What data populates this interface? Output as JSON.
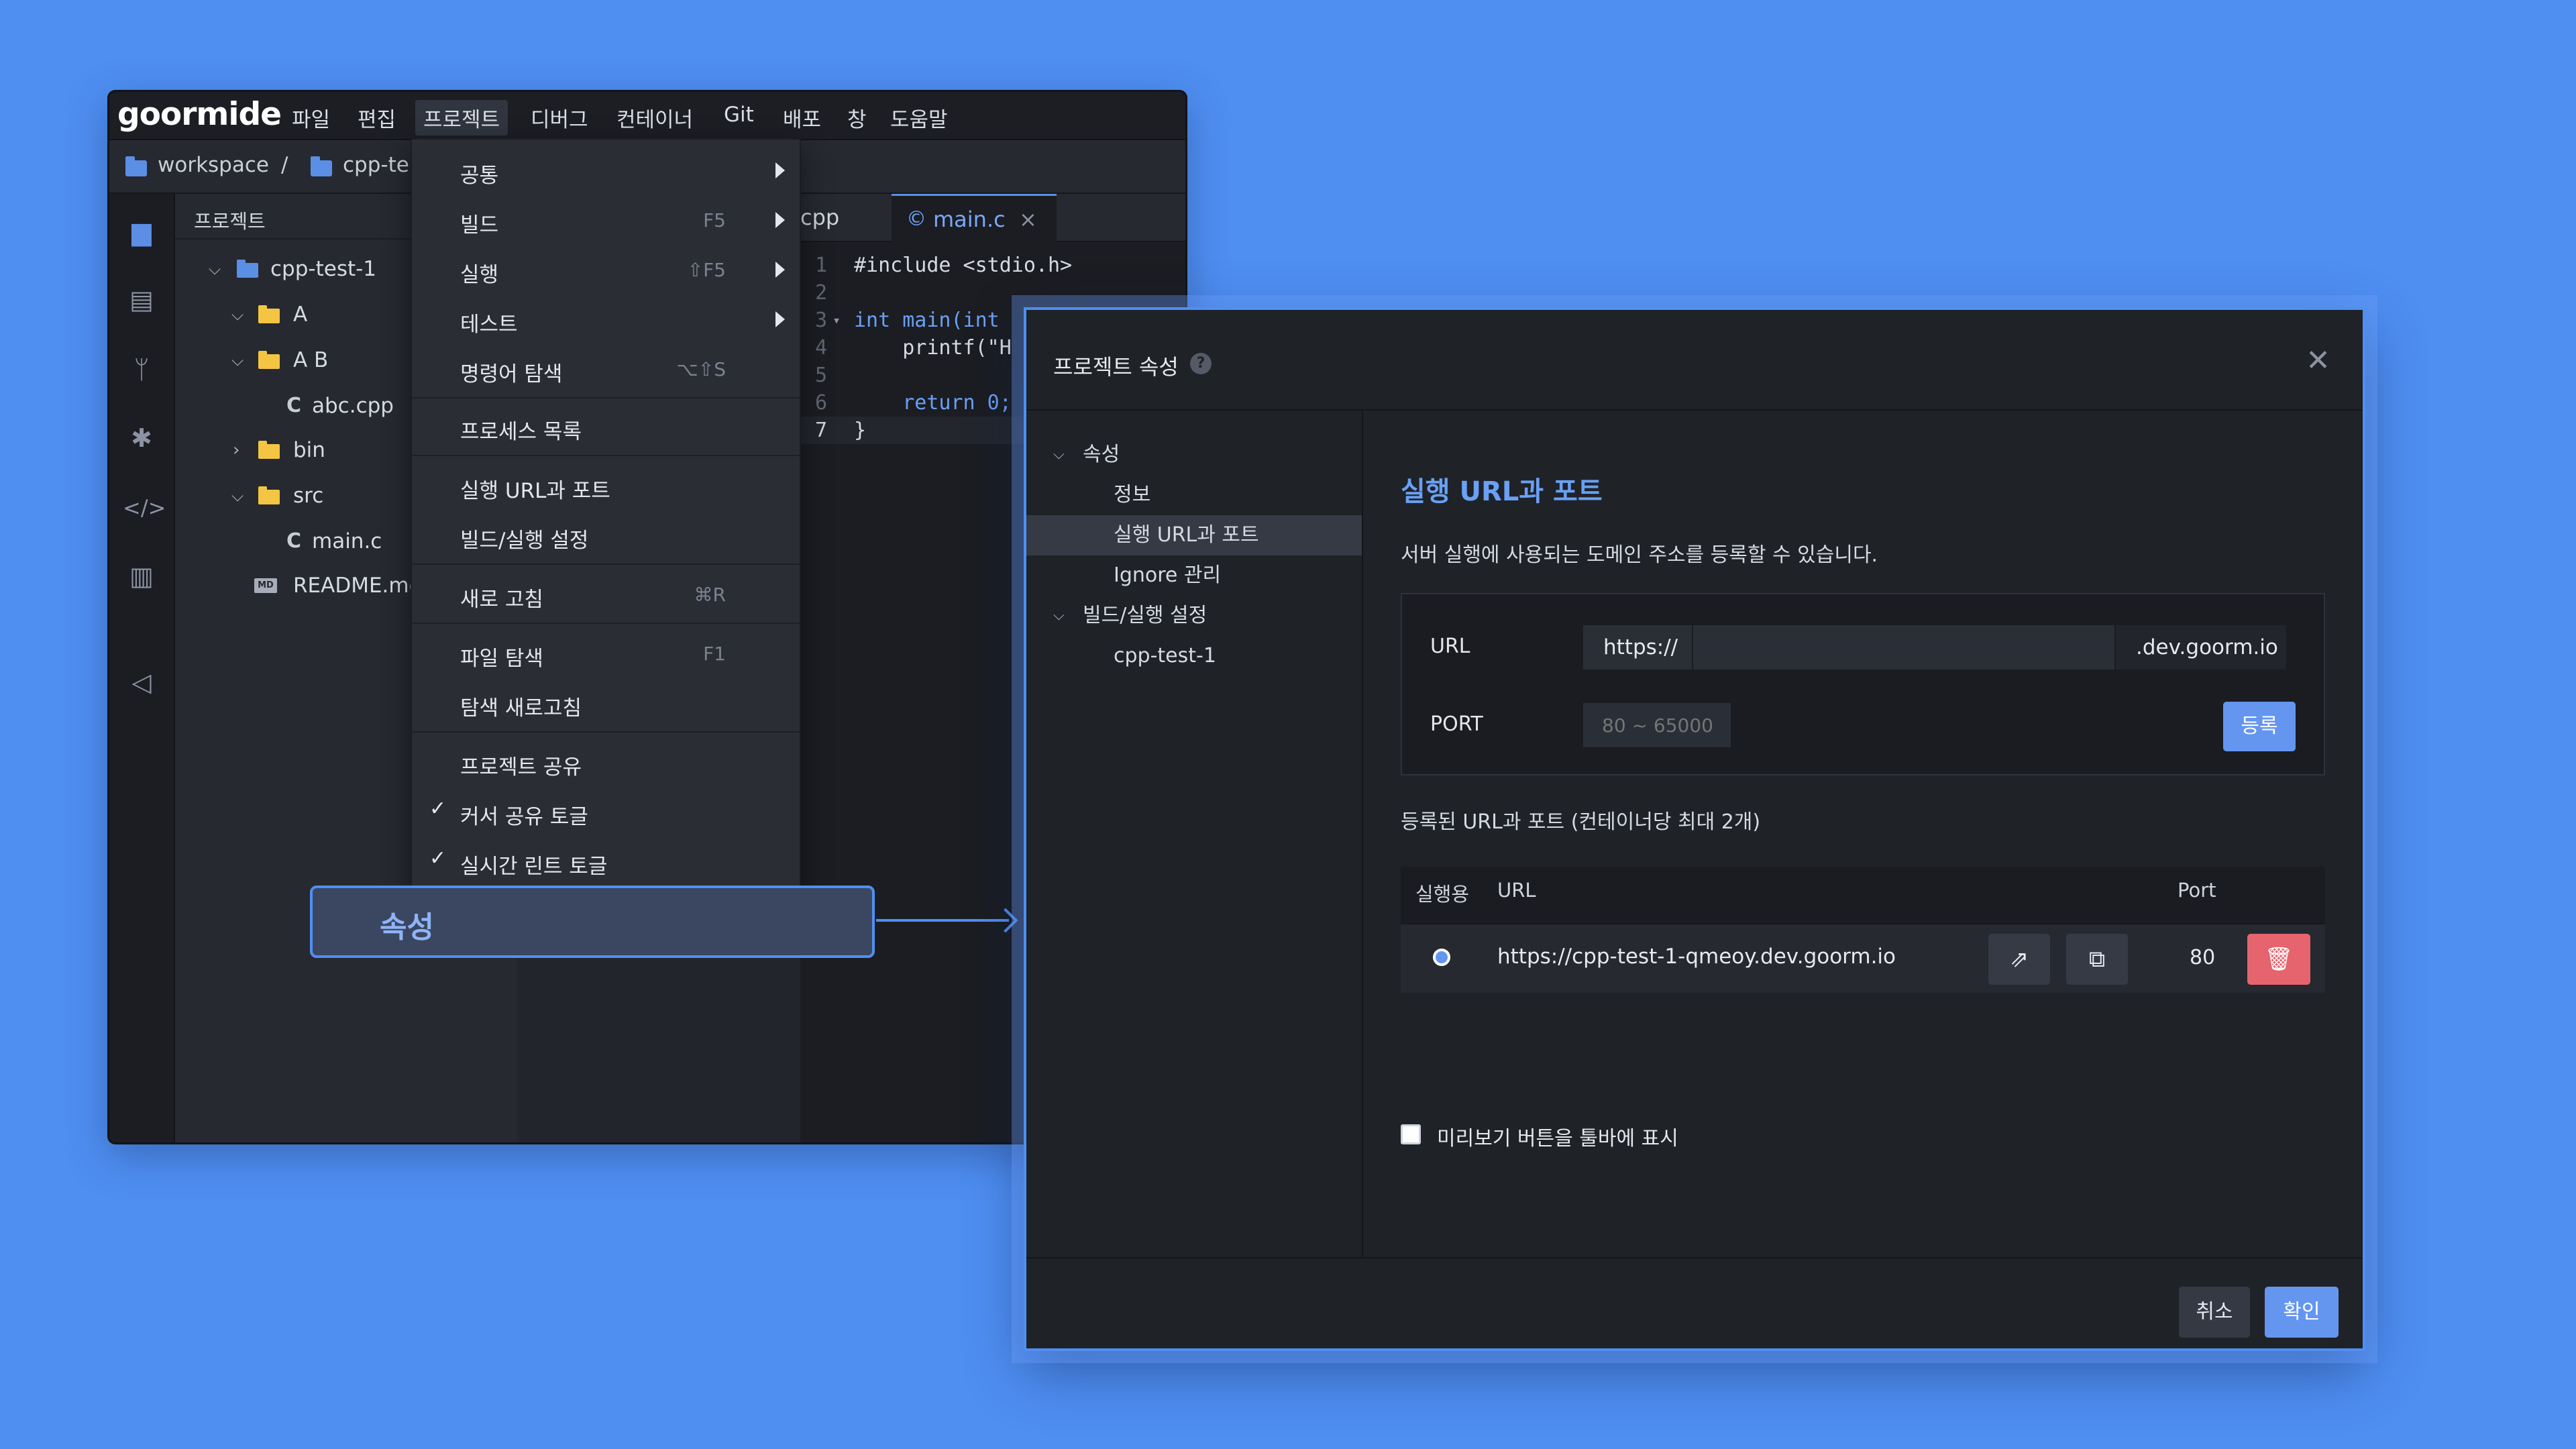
{
  "menubar": {
    "logo": "goormide",
    "items": [
      "파일",
      "편집",
      "프로젝트",
      "디버그",
      "컨테이너",
      "Git",
      "배포",
      "창",
      "도움말"
    ]
  },
  "breadcrumb": {
    "workspace": "workspace",
    "separator": "/",
    "project": "cpp-te"
  },
  "explorer": {
    "title": "프로젝트",
    "tree": [
      {
        "name": "cpp-test-1",
        "type": "project"
      },
      {
        "name": "A",
        "type": "folder"
      },
      {
        "name": "A B",
        "type": "folder"
      },
      {
        "name": "abc.cpp",
        "type": "file"
      },
      {
        "name": "bin",
        "type": "folder"
      },
      {
        "name": "src",
        "type": "folder"
      },
      {
        "name": "main.c",
        "type": "file"
      },
      {
        "name": "README.md",
        "type": "md"
      }
    ]
  },
  "editor": {
    "tabs": [
      {
        "label": "cpp"
      },
      {
        "label": "main.c"
      }
    ],
    "line_numbers": [
      "1",
      "2",
      "3",
      "4",
      "5",
      "6",
      "7"
    ],
    "lines": [
      "#include <stdio.h>",
      "",
      "int main(int",
      "    printf(\"H",
      "",
      "    return 0;",
      "}"
    ]
  },
  "dropdown": {
    "items": [
      {
        "label": "공통",
        "shortcut": "",
        "submenu": true
      },
      {
        "label": "빌드",
        "shortcut": "F5",
        "submenu": true
      },
      {
        "label": "실행",
        "shortcut": "⇧F5",
        "submenu": true
      },
      {
        "label": "테스트",
        "shortcut": "",
        "submenu": true
      },
      {
        "label": "명령어 탐색",
        "shortcut": "⌥⇧S"
      },
      {
        "label": "프로세스 목록",
        "shortcut": ""
      },
      {
        "label": "실행 URL과 포트",
        "shortcut": ""
      },
      {
        "label": "빌드/실행 설정",
        "shortcut": ""
      },
      {
        "label": "새로 고침",
        "shortcut": "⌘R"
      },
      {
        "label": "파일 탐색",
        "shortcut": "F1"
      },
      {
        "label": "탐색 새로고침",
        "shortcut": ""
      },
      {
        "label": "프로젝트 공유",
        "shortcut": ""
      },
      {
        "label": "커서 공유 토글",
        "shortcut": "",
        "checked": true
      },
      {
        "label": "실시간 린트 토글",
        "shortcut": "",
        "checked": true
      }
    ],
    "highlight_label": "속성"
  },
  "dialog": {
    "title": "프로젝트 속성",
    "help": "?",
    "close": "✕",
    "sidebar": {
      "group1": "속성",
      "group1_items": [
        "정보",
        "실행 URL과 포트",
        "Ignore 관리"
      ],
      "group2": "빌드/실행 설정",
      "group2_items": [
        "cpp-test-1"
      ]
    },
    "section_title": "실행 URL과 포트",
    "description": "서버 실행에 사용되는 도메인 주소를 등록할 수 있습니다.",
    "form": {
      "url_label": "URL",
      "url_prefix": "https://",
      "url_value": "",
      "url_suffix": ".dev.goorm.io",
      "port_label": "PORT",
      "port_placeholder": "80 ~ 65000",
      "register_button": "등록"
    },
    "registered_title": "등록된 URL과 포트 (컨테이너당 최대 2개)",
    "table": {
      "headers": [
        "실행용",
        "URL",
        "Port"
      ],
      "rows": [
        {
          "url": "https://cpp-test-1-qmeoy.dev.goorm.io",
          "port": "80"
        }
      ]
    },
    "preview_checkbox_label": "미리보기 버튼을 툴바에 표시",
    "cancel": "취소",
    "confirm": "확인"
  }
}
